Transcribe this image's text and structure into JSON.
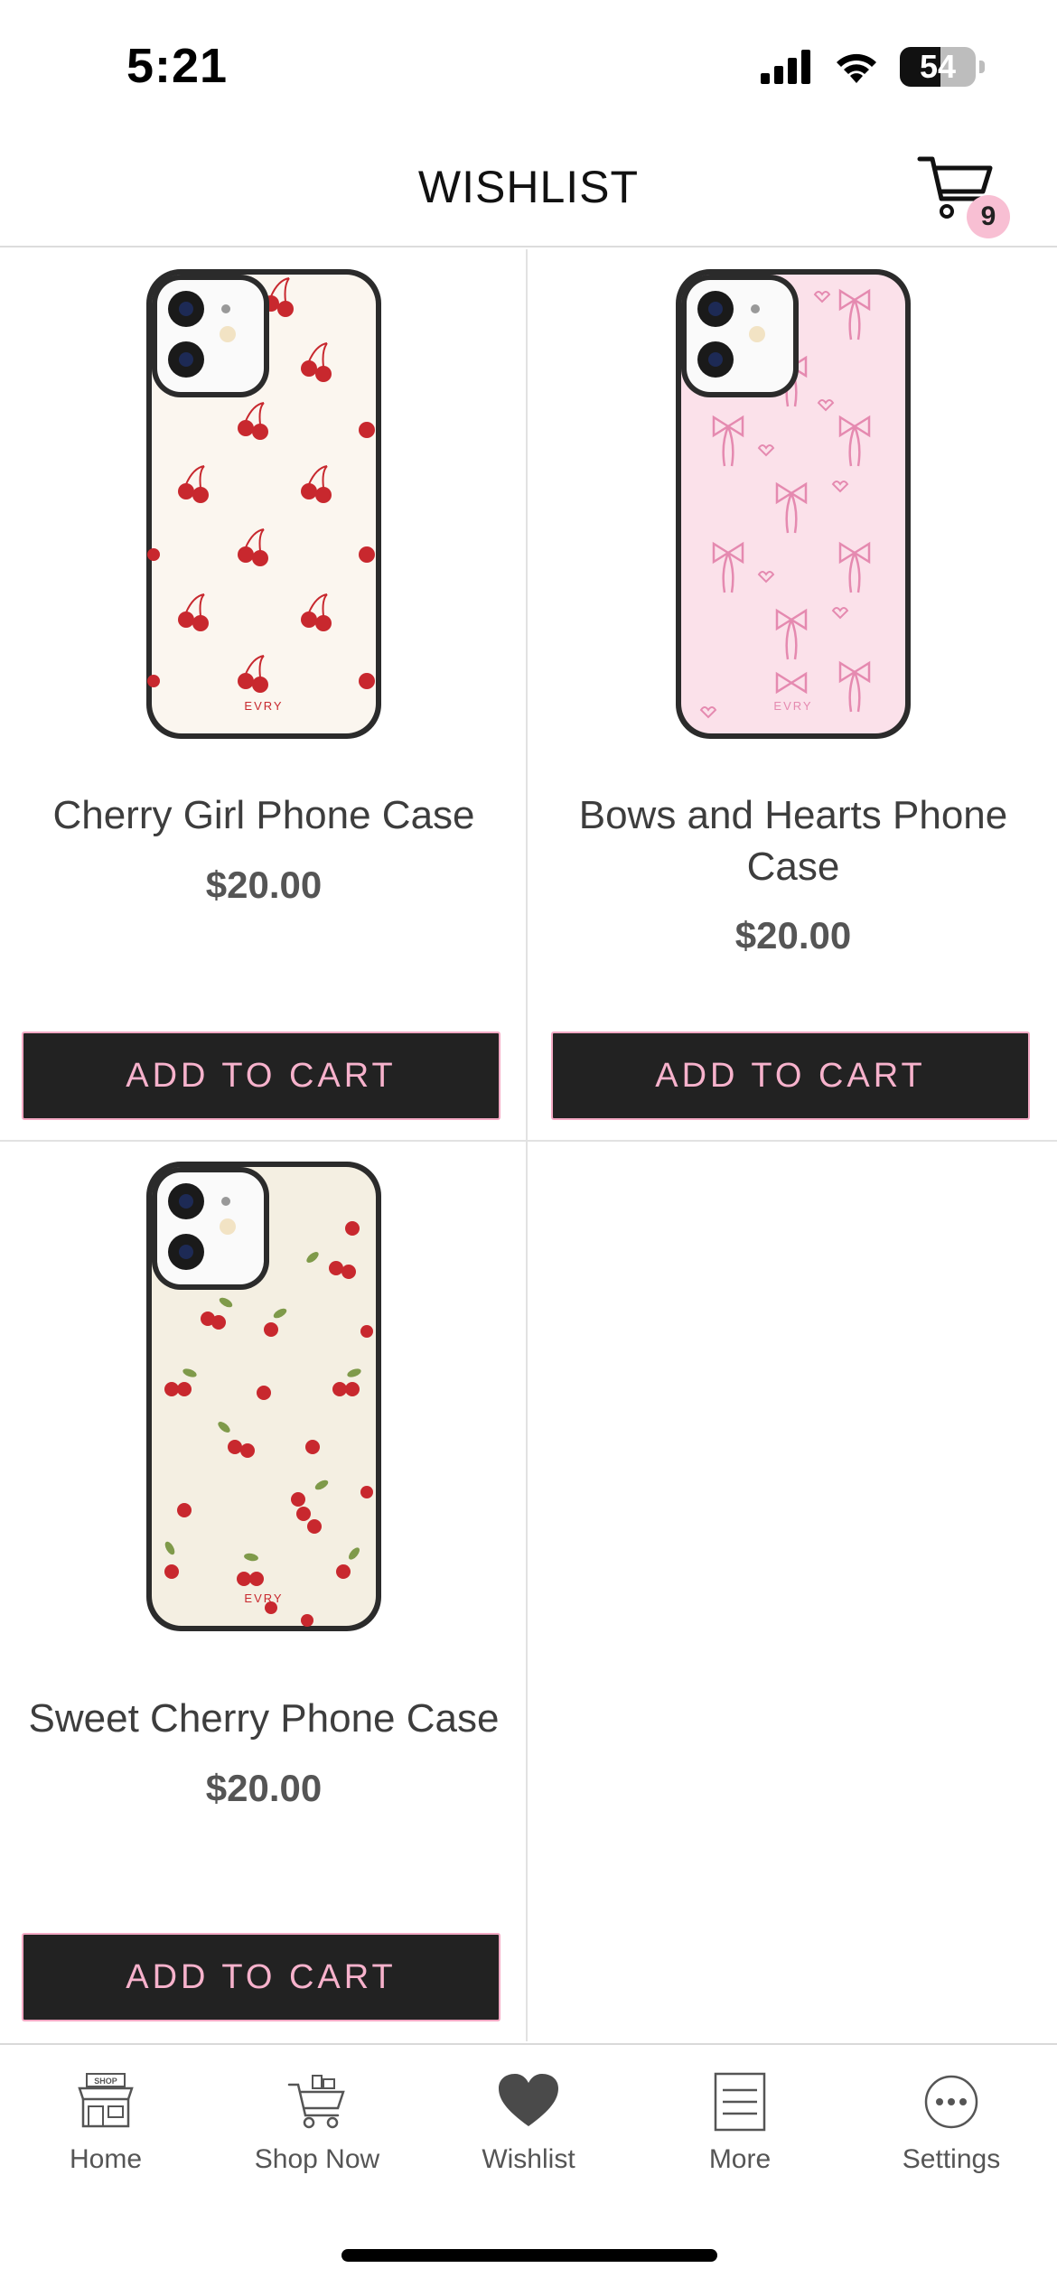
{
  "status_bar": {
    "time": "5:21",
    "battery_level": "54",
    "icons": [
      "cellular-signal-icon",
      "wifi-icon",
      "battery-icon"
    ]
  },
  "header": {
    "title": "WISHLIST",
    "cart_count": "9",
    "cart_icon": "shopping-cart-icon"
  },
  "products": [
    {
      "name": "Cherry Girl Phone Case",
      "price": "$20.00",
      "button": "ADD TO CART",
      "case_color": "#fbf6ef",
      "brand_mark": "EVRY"
    },
    {
      "name": "Bows and Hearts Phone Case",
      "price": "$20.00",
      "button": "ADD TO CART",
      "case_color": "#fbe1ea",
      "brand_mark": "EVRY"
    },
    {
      "name": "Sweet Cherry Phone Case",
      "price": "$20.00",
      "button": "ADD TO CART",
      "case_color": "#f4efe2",
      "brand_mark": "EVRY"
    }
  ],
  "tab_bar": {
    "tabs": [
      {
        "label": "Home",
        "icon": "shop-storefront-icon",
        "active": false
      },
      {
        "label": "Shop Now",
        "icon": "shopping-cart-icon",
        "active": false
      },
      {
        "label": "Wishlist",
        "icon": "heart-icon",
        "active": true
      },
      {
        "label": "More",
        "icon": "list-icon",
        "active": false
      },
      {
        "label": "Settings",
        "icon": "more-dots-icon",
        "active": false
      }
    ],
    "home_icon_text": "SHOP"
  },
  "colors": {
    "button_bg": "#222222",
    "button_text": "#f7b2cc",
    "badge_bg": "#f8bfd3",
    "cherry_red": "#c8282e",
    "bow_pink": "#e58ab0"
  }
}
